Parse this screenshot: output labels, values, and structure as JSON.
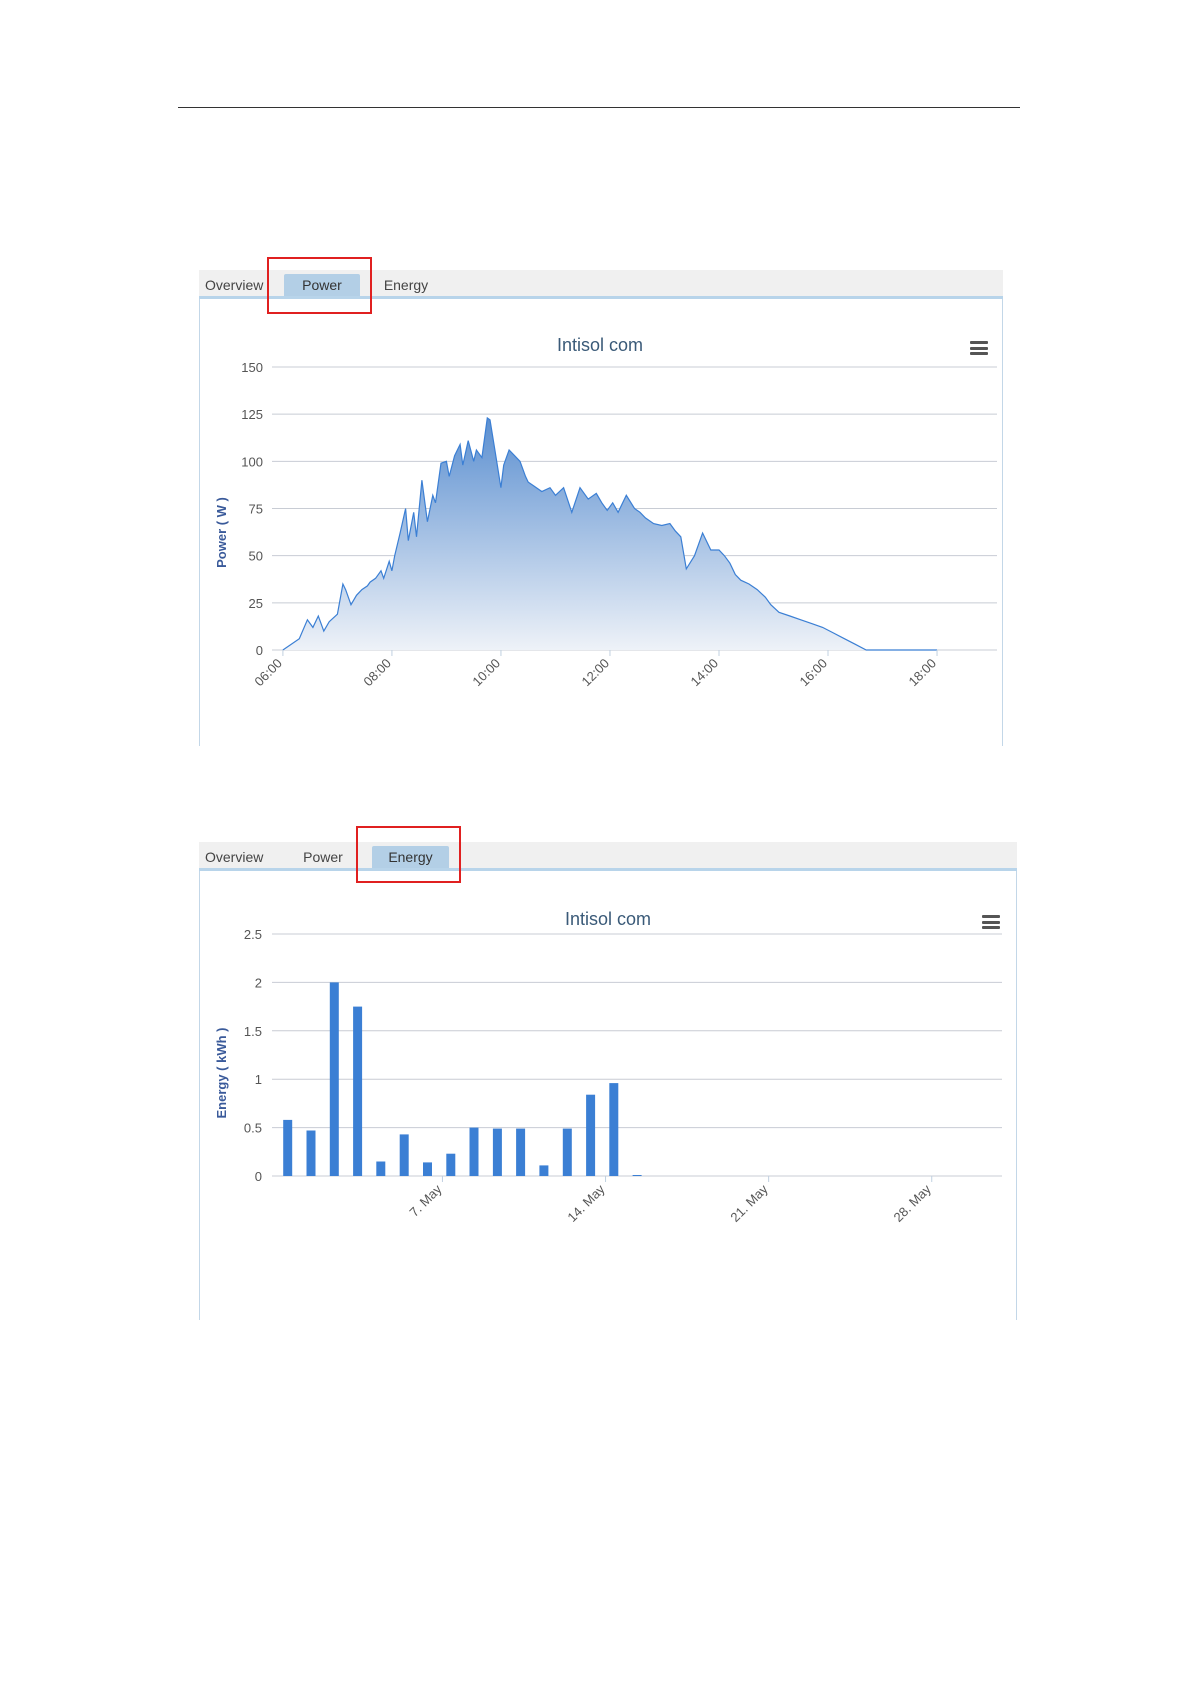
{
  "power_panel": {
    "tabs": [
      {
        "label": "Overview",
        "active": false
      },
      {
        "label": "Power",
        "active": true
      },
      {
        "label": "Energy",
        "active": false
      }
    ],
    "menu_icon": "hamburger-menu-icon"
  },
  "energy_panel": {
    "tabs": [
      {
        "label": "Overview",
        "active": false
      },
      {
        "label": "Power",
        "active": false
      },
      {
        "label": "Energy",
        "active": true
      }
    ],
    "menu_icon": "hamburger-menu-icon"
  },
  "colors": {
    "series": "#3b7fd4",
    "area_top": "#5b8fd0",
    "grid": "#c8ccd4",
    "axis_title": "#3a5a9a",
    "highlight": "#e02020"
  },
  "chart_data": [
    {
      "type": "area",
      "title": "Intisol com",
      "ylabel": "Power ( W )",
      "xlabel": "",
      "ylim": [
        0,
        150
      ],
      "y_ticks": [
        "0",
        "25",
        "50",
        "75",
        "100",
        "125",
        "150"
      ],
      "x_ticks": [
        "06:00",
        "08:00",
        "10:00",
        "12:00",
        "14:00",
        "16:00",
        "18:00"
      ],
      "x_unit": "hour",
      "grid": true,
      "series": [
        {
          "x": [
            6.0,
            6.3,
            6.45,
            6.55,
            6.65,
            6.75,
            6.85,
            7.0,
            7.1,
            7.15,
            7.25,
            7.35,
            7.45,
            7.55,
            7.6,
            7.7,
            7.8,
            7.85,
            7.95,
            8.0,
            8.05,
            8.15,
            8.25,
            8.3,
            8.4,
            8.45,
            8.55,
            8.65,
            8.75,
            8.8,
            8.9,
            9.0,
            9.05,
            9.15,
            9.25,
            9.3,
            9.4,
            9.5,
            9.55,
            9.65,
            9.75,
            9.8,
            9.9,
            10.0,
            10.05,
            10.15,
            10.25,
            10.35,
            10.45,
            10.5,
            10.6,
            10.75,
            10.9,
            11.0,
            11.15,
            11.3,
            11.45,
            11.6,
            11.75,
            11.85,
            11.95,
            12.05,
            12.15,
            12.3,
            12.45,
            12.55,
            12.65,
            12.8,
            12.95,
            13.1,
            13.2,
            13.3,
            13.4,
            13.55,
            13.7,
            13.85,
            14.0,
            14.1,
            14.2,
            14.3,
            14.4,
            14.55,
            14.7,
            14.85,
            14.95,
            15.1,
            15.3,
            15.5,
            15.7,
            15.9,
            16.1,
            16.3,
            16.5,
            16.7,
            16.9,
            17.1,
            17.3,
            17.5,
            17.7,
            17.9,
            18.0
          ],
          "y": [
            0,
            6,
            16,
            12,
            18,
            10,
            15,
            19,
            35,
            32,
            24,
            29,
            32,
            34,
            36,
            38,
            42,
            38,
            47,
            42,
            50,
            62,
            75,
            58,
            73,
            60,
            90,
            68,
            82,
            78,
            99,
            100,
            92,
            103,
            109,
            98,
            111,
            100,
            106,
            102,
            123,
            122,
            104,
            86,
            98,
            106,
            103,
            100,
            92,
            89,
            87,
            84,
            86,
            82,
            86,
            73,
            86,
            80,
            83,
            78,
            74,
            78,
            73,
            82,
            75,
            73,
            70,
            67,
            66,
            67,
            63,
            60,
            43,
            50,
            62,
            53,
            53,
            50,
            46,
            40,
            37,
            35,
            32,
            28,
            24,
            20,
            18,
            16,
            14,
            12,
            9,
            6,
            3,
            0,
            0,
            0,
            0,
            0,
            0,
            0,
            0
          ]
        }
      ]
    },
    {
      "type": "bar",
      "title": "Intisol com",
      "ylabel": "Energy ( kWh )",
      "xlabel": "",
      "ylim": [
        0,
        2.5
      ],
      "y_ticks": [
        "0",
        "0.5",
        "1",
        "1.5",
        "2",
        "2.5"
      ],
      "x_ticks": [
        "7. May",
        "14. May",
        "21. May",
        "28. May"
      ],
      "grid": true,
      "categories": [
        "1. May",
        "2. May",
        "3. May",
        "4. May",
        "5. May",
        "6. May",
        "7. May",
        "8. May",
        "9. May",
        "10. May",
        "11. May",
        "12. May",
        "13. May",
        "14. May",
        "15. May",
        "16. May"
      ],
      "series": [
        {
          "values": [
            0.58,
            0.47,
            2.0,
            1.75,
            0.15,
            0.43,
            0.14,
            0.23,
            0.5,
            0.49,
            0.49,
            0.11,
            0.49,
            0.84,
            0.96,
            0.01
          ]
        }
      ]
    }
  ]
}
